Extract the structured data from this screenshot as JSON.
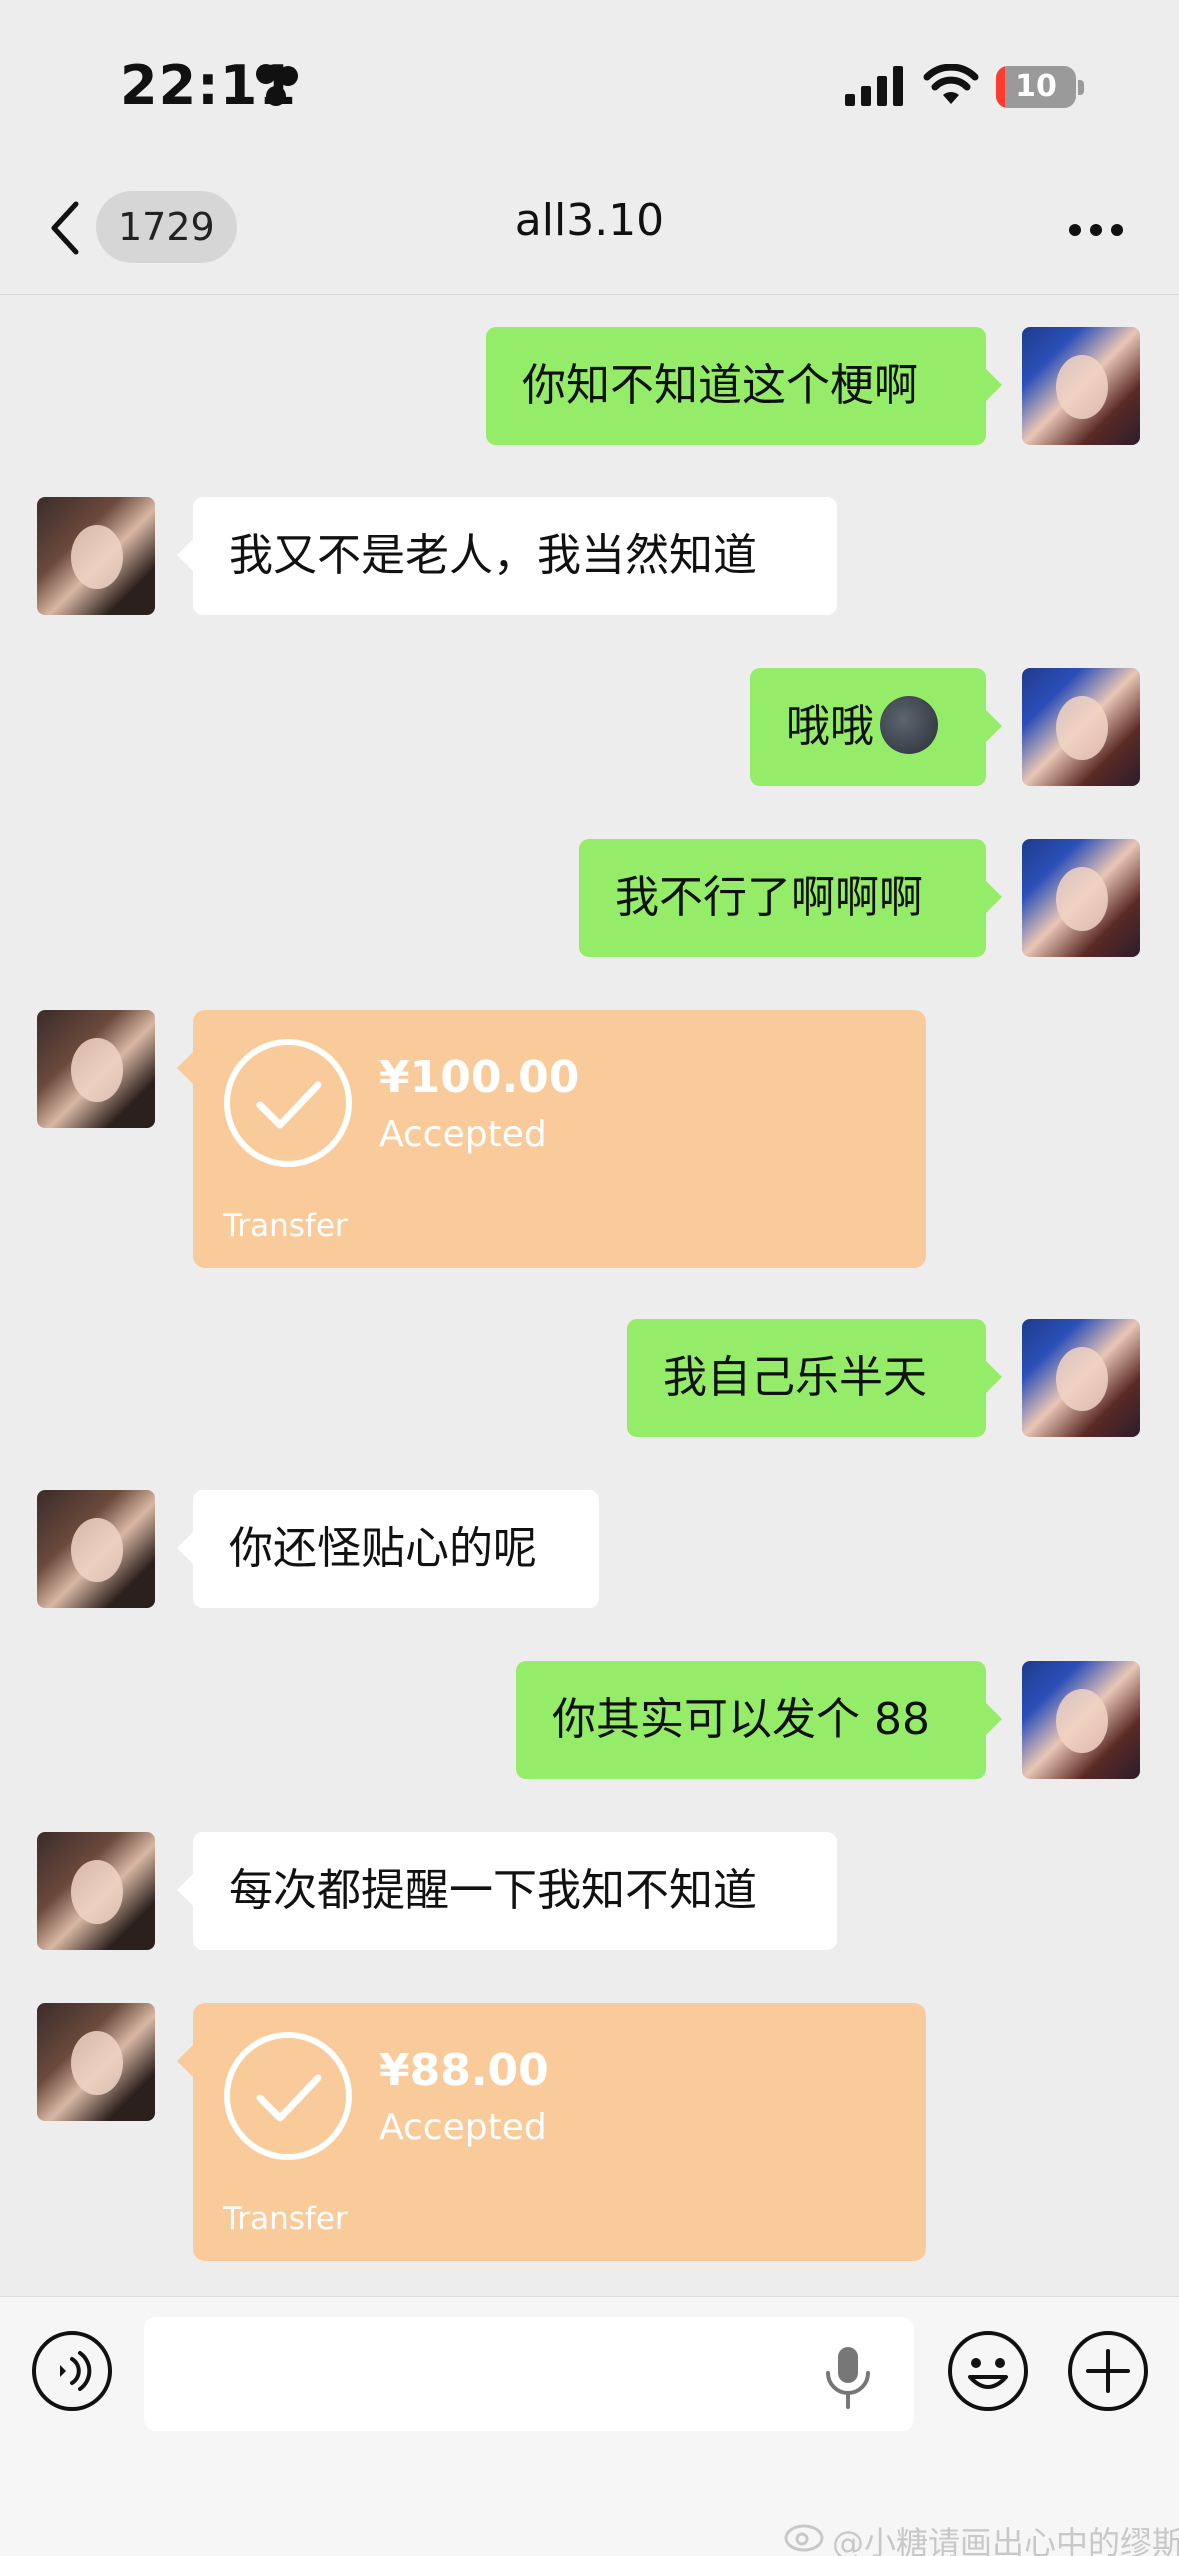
{
  "status_bar": {
    "time": "22:11",
    "battery": "10"
  },
  "nav": {
    "unread_count": "1729",
    "title": "all3.10"
  },
  "messages": {
    "m1": "你知不知道这个梗啊",
    "m2": "我又不是老人，我当然知道",
    "m3": "哦哦",
    "m4": "我不行了啊啊啊",
    "m6": "我自己乐半天",
    "m7": "你还怪贴心的呢",
    "m8": "你其实可以发个 88",
    "m9": "每次都提醒一下我知不知道"
  },
  "transfers": {
    "t1": {
      "amount": "¥100.00",
      "status": "Accepted",
      "label": "Transfer"
    },
    "t2": {
      "amount": "¥88.00",
      "status": "Accepted",
      "label": "Transfer"
    }
  },
  "watermark": "@小糖请画出心中的缪斯",
  "colors": {
    "sent_bubble": "#95ec69",
    "received_bubble": "#ffffff",
    "transfer": "#f9cb9b",
    "background": "#ededed"
  }
}
